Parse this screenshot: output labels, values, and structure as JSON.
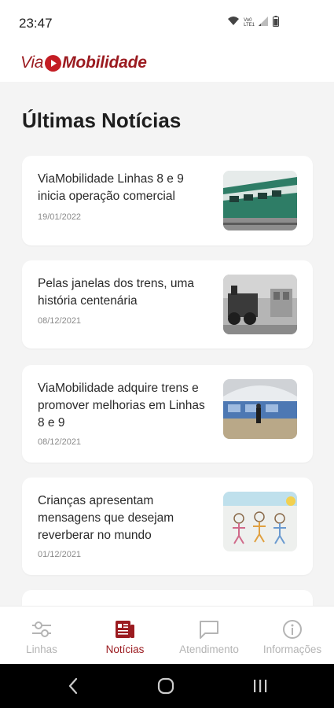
{
  "status_bar": {
    "time": "23:47",
    "network_top": "Vo0",
    "network_bottom": "LTE1"
  },
  "app": {
    "logo_via": "Via",
    "logo_mobilidade": "Mobilidade",
    "brand_color": "#9b1b20",
    "accent_color": "#c41d24"
  },
  "page": {
    "title": "Últimas Notícias"
  },
  "news": [
    {
      "title": "ViaMobilidade Linhas 8 e 9 inicia operação comercial",
      "date": "19/01/2022",
      "thumb_icon": "green-train-photo"
    },
    {
      "title": "Pelas janelas dos trens, uma história centenária",
      "date": "08/12/2021",
      "thumb_icon": "steam-locomotive-photo"
    },
    {
      "title": "ViaMobilidade adquire trens e promover melhorias em Linhas 8 e 9",
      "date": "08/12/2021",
      "thumb_icon": "station-platform-photo"
    },
    {
      "title": "Crianças apresentam mensagens que desejam reverberar no mundo",
      "date": "01/12/2021",
      "thumb_icon": "children-drawing-photo"
    }
  ],
  "bottom_nav": [
    {
      "label": "Linhas",
      "icon": "lines-icon",
      "active": false
    },
    {
      "label": "Notícias",
      "icon": "news-icon",
      "active": true
    },
    {
      "label": "Atendimento",
      "icon": "chat-icon",
      "active": false
    },
    {
      "label": "Informações",
      "icon": "info-icon",
      "active": false
    }
  ]
}
